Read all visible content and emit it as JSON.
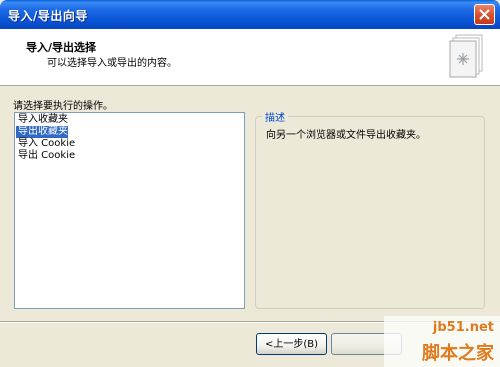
{
  "window": {
    "title": "导入/导出向导"
  },
  "header": {
    "title": "导入/导出选择",
    "subtitle": "可以选择导入或导出的内容。"
  },
  "prompt": "请选择要执行的操作。",
  "actions": [
    {
      "label": "导入收藏夹",
      "selected": false
    },
    {
      "label": "导出收藏夹",
      "selected": true
    },
    {
      "label": "导入 Cookie",
      "selected": false
    },
    {
      "label": "导出 Cookie",
      "selected": false
    }
  ],
  "description": {
    "legend": "描述",
    "text": "向另一个浏览器或文件导出收藏夹。"
  },
  "buttons": {
    "back": "<上一步(B)",
    "next": ""
  },
  "watermark": {
    "site": "jb51.net",
    "name": "脚本之家"
  },
  "colors": {
    "selection": "#316ac5",
    "titlebar": "#0a55d6",
    "legend": "#0046d5",
    "watermark": "#e07a1f"
  }
}
